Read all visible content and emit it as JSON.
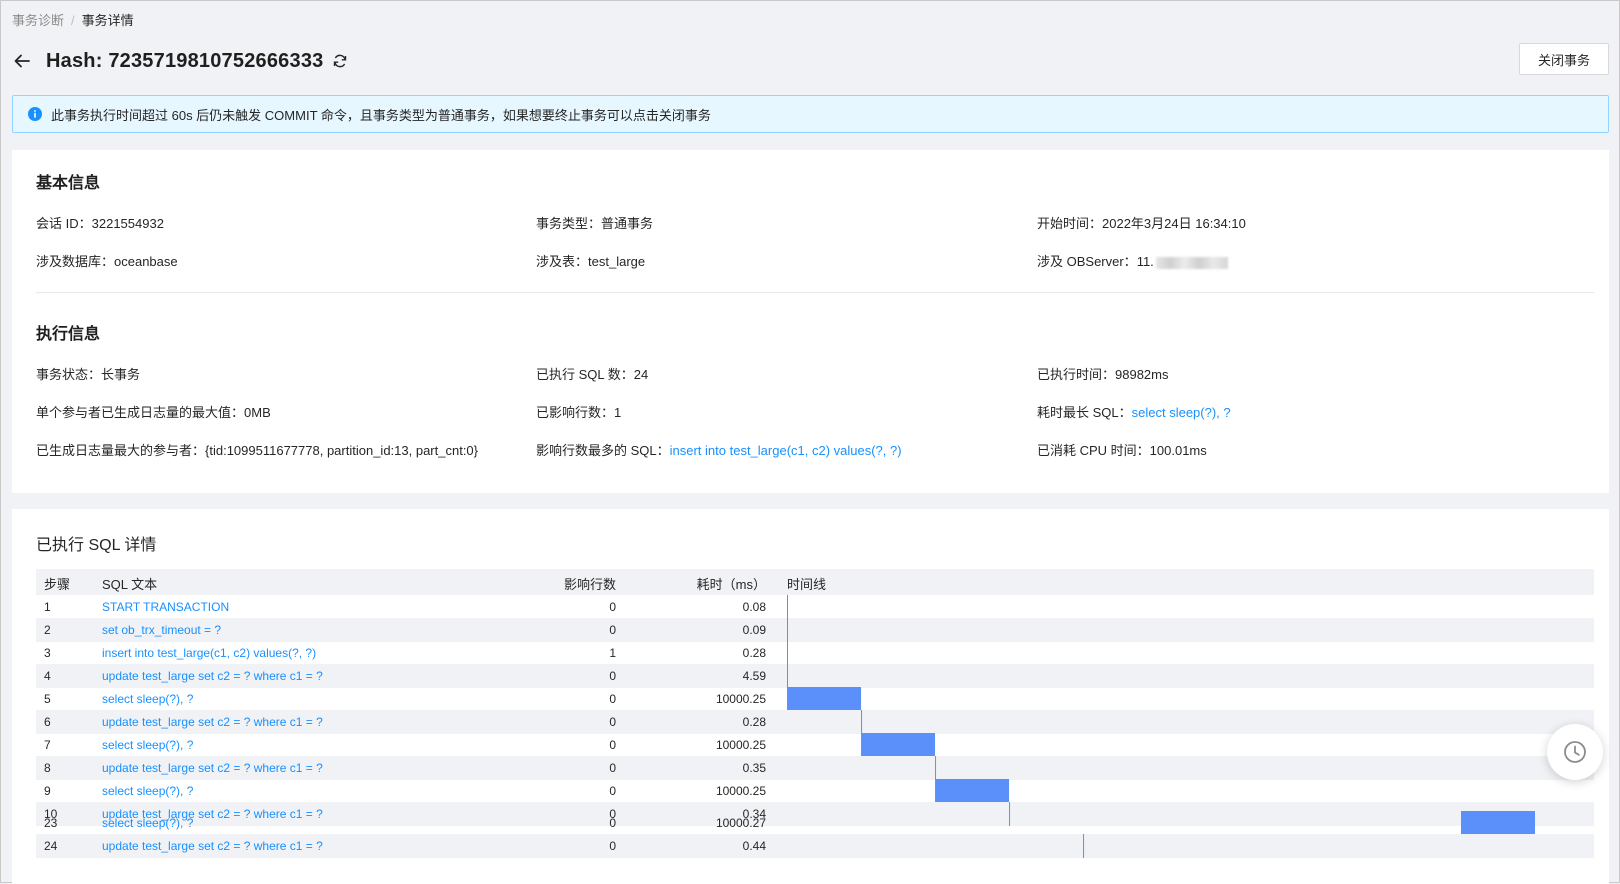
{
  "breadcrumb": {
    "parent": "事务诊断",
    "current": "事务详情"
  },
  "header": {
    "title": "Hash: 7235719810752666333",
    "close_button": "关闭事务"
  },
  "alert": {
    "text": "此事务执行时间超过 60s 后仍未触发 COMMIT 命令，且事务类型为普通事务，如果想要终止事务可以点击关闭事务"
  },
  "basic": {
    "title": "基本信息",
    "session_label": "会话 ID：",
    "session_value": "3221554932",
    "type_label": "事务类型：",
    "type_value": "普通事务",
    "start_label": "开始时间：",
    "start_value": "2022年3月24日 16:34:10",
    "db_label": "涉及数据库：",
    "db_value": "oceanbase",
    "table_label": "涉及表：",
    "table_value": "test_large",
    "server_label": "涉及 OBServer：",
    "server_value": "11."
  },
  "exec": {
    "title": "执行信息",
    "status_label": "事务状态：",
    "status_value": "长事务",
    "sqlcount_label": "已执行 SQL 数：",
    "sqlcount_value": "24",
    "time_label": "已执行时间：",
    "time_value": "98982ms",
    "maxlog_label": "单个参与者已生成日志量的最大值：",
    "maxlog_value": "0MB",
    "affected_label": "已影响行数：",
    "affected_value": "1",
    "longest_label": "耗时最长 SQL：",
    "longest_value": "select sleep(?), ?",
    "participant_label": "已生成日志量最大的参与者：",
    "participant_value": "{tid:1099511677778, partition_id:13, part_cnt:0}",
    "mostrows_label": "影响行数最多的 SQL：",
    "mostrows_value": "insert into test_large(c1, c2) values(?, ?)",
    "cpu_label": "已消耗 CPU 时间：",
    "cpu_value": "100.01ms"
  },
  "sql_table": {
    "title": "已执行 SQL 详情",
    "columns": [
      "步骤",
      "SQL 文本",
      "影响行数",
      "耗时（ms）",
      "时间线"
    ],
    "rows": [
      {
        "step": "1",
        "sql": "START TRANSACTION",
        "rows": "0",
        "cost": "0.08"
      },
      {
        "step": "2",
        "sql": "set ob_trx_timeout = ?",
        "rows": "0",
        "cost": "0.09"
      },
      {
        "step": "3",
        "sql": "insert into test_large(c1, c2) values(?, ?)",
        "rows": "1",
        "cost": "0.28"
      },
      {
        "step": "4",
        "sql": "update test_large set c2 = ? where c1 = ?",
        "rows": "0",
        "cost": "4.59"
      },
      {
        "step": "5",
        "sql": "select sleep(?), ?",
        "rows": "0",
        "cost": "10000.25"
      },
      {
        "step": "6",
        "sql": "update test_large set c2 = ? where c1 = ?",
        "rows": "0",
        "cost": "0.28"
      },
      {
        "step": "7",
        "sql": "select sleep(?), ?",
        "rows": "0",
        "cost": "10000.25"
      },
      {
        "step": "8",
        "sql": "update test_large set c2 = ? where c1 = ?",
        "rows": "0",
        "cost": "0.35"
      },
      {
        "step": "9",
        "sql": "select sleep(?), ?",
        "rows": "0",
        "cost": "10000.25"
      },
      {
        "step": "10",
        "sql": "update test_large set c2 = ? where c1 = ?",
        "rows": "0",
        "cost": "0.34"
      },
      {
        "step": "23",
        "sql": "select sleep(?), ?",
        "rows": "0",
        "cost": "10000.27"
      },
      {
        "step": "24",
        "sql": "update test_large set c2 = ? where c1 = ?",
        "rows": "0",
        "cost": "0.44"
      }
    ]
  },
  "colors": {
    "accent": "#1890ff",
    "bar": "#5b8ff9",
    "alert_bg": "#e6f7ff",
    "alert_border": "#91d5ff"
  },
  "icons": {
    "back": "arrow-left-icon",
    "refresh": "refresh-icon",
    "info": "info-circle-icon",
    "history": "clock-history-icon"
  }
}
